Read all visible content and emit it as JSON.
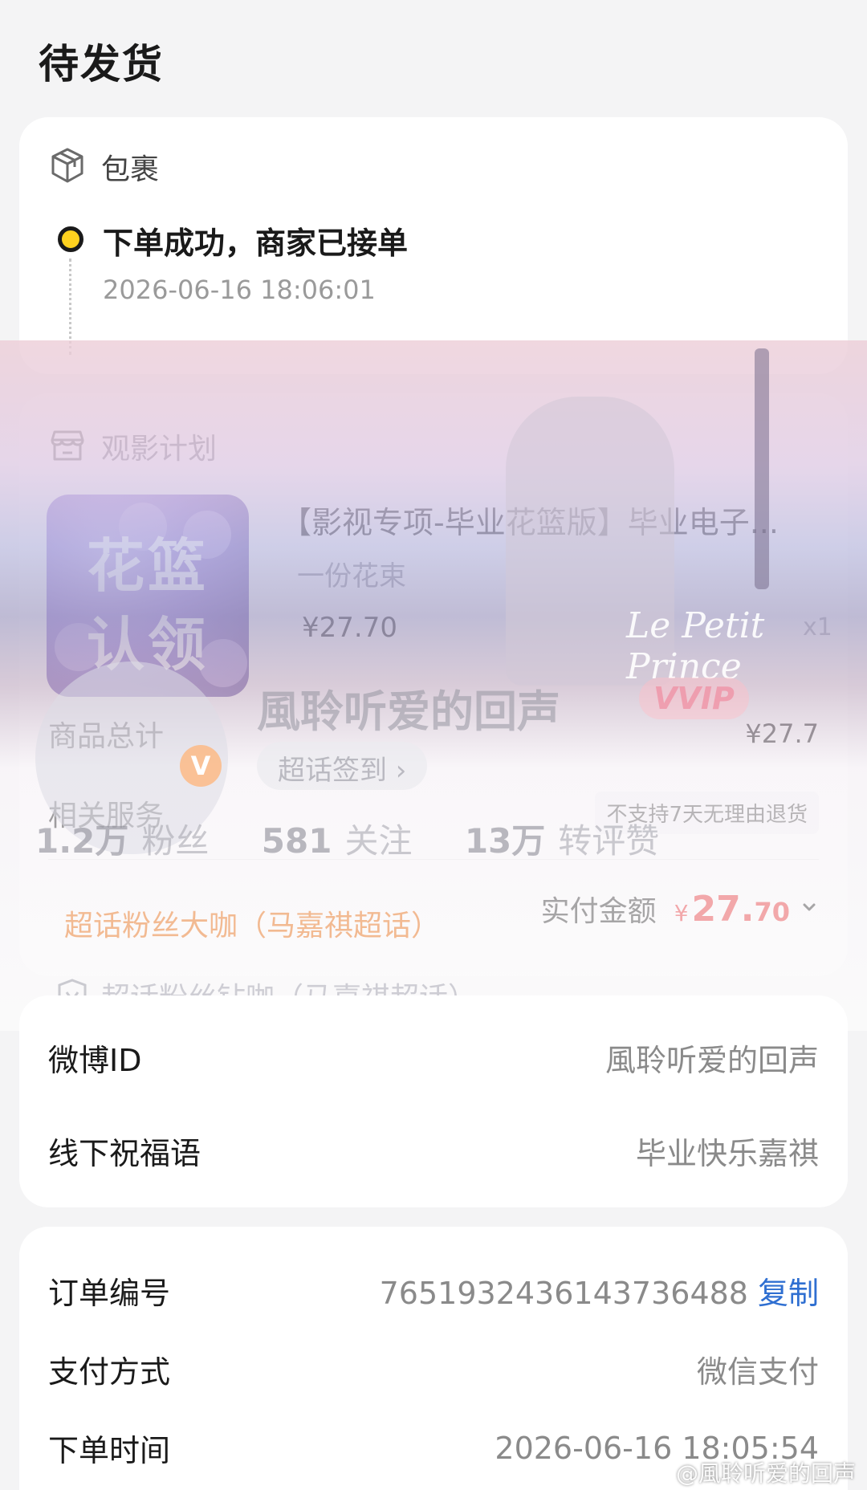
{
  "page": {
    "title": "待发货"
  },
  "package": {
    "header_label": "包裹",
    "status_text": "下单成功，商家已接单",
    "status_time": "2026-06-16 18:06:01"
  },
  "product": {
    "shop_label": "观影计划",
    "thumb_text_line1": "花篮",
    "thumb_text_line2": "认领",
    "title": "【影视专项-毕业花篮版】毕业电子...",
    "sku": "一份花束",
    "price": "¥27.70",
    "quantity": "x1",
    "total_label": "商品总计",
    "total_value": "¥27.7",
    "service_label": "相关服务",
    "service_value": "不支持7天无理由退货",
    "paid_label": "实付金额",
    "paid_currency": "¥",
    "paid_integer": "27.",
    "paid_decimal": "70"
  },
  "overlay": {
    "profile_name": "風聆听爱的回声",
    "vvip_badge": "VVIP",
    "checkin_label": "超话签到 ›",
    "verified_mark": "V",
    "stats": [
      {
        "num": "1.2万",
        "label": "粉丝"
      },
      {
        "num": "581",
        "label": "关注"
      },
      {
        "num": "13万",
        "label": "转评赞"
      }
    ],
    "fan_title_1": "超话粉丝大咖（马嘉祺超话）",
    "fan_title_2": "超话粉丝钻咖（马嘉祺超话）",
    "decor_text": "Le Petit Prince"
  },
  "weibo": {
    "id_label": "微博ID",
    "id_value": "風聆听爱的回声",
    "blessing_label": "线下祝福语",
    "blessing_value": "毕业快乐嘉祺"
  },
  "order": {
    "number_label": "订单编号",
    "number_value": "7651932436143736488",
    "copy_label": "复制",
    "payment_label": "支付方式",
    "payment_value": "微信支付",
    "time_label": "下单时间",
    "time_value": "2026-06-16 18:05:54"
  },
  "watermark": "@風聆听爱的回声",
  "colors": {
    "accent_yellow": "#ffd21f",
    "price_red": "#e4393c",
    "link_blue": "#2f6fd1"
  }
}
